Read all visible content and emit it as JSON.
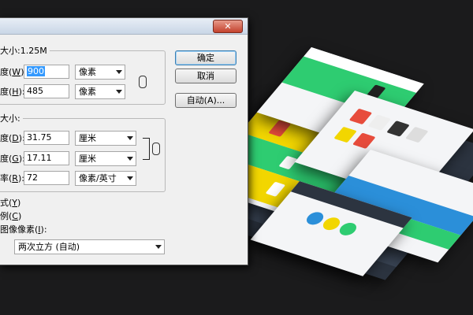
{
  "dialog": {
    "close_icon": "close-icon",
    "pixel_dimensions": {
      "legend": "大小:1.25M",
      "width_label": "度(",
      "width_key": "W",
      "width_value": "900",
      "width_unit": "像素",
      "height_label": "度(",
      "height_key": "H",
      "height_value": "485",
      "height_unit": "像素"
    },
    "document_size": {
      "legend": "大小:",
      "width_label": "度(",
      "width_key": "D",
      "width_value": "31.75",
      "width_unit": "厘米",
      "height_label": "度(",
      "height_key": "G",
      "height_value": "17.11",
      "height_unit": "厘米",
      "resolution_label": "率(",
      "resolution_key": "R",
      "resolution_value": "72",
      "resolution_unit": "像素/英寸"
    },
    "buttons": {
      "ok": "确定",
      "cancel": "取消",
      "auto": "自动(A)..."
    },
    "options": {
      "scale_styles_label": "式(",
      "scale_styles_key": "Y",
      "constrain_label": "例(",
      "constrain_key": "C",
      "resample_label": "图像像素(",
      "resample_key": "I",
      "resample_value": "两次立方 (自动)"
    },
    "close_paren": ")",
    "close_paren_colon": "):"
  },
  "colors": {
    "dialog_bg": "#f0f0f0",
    "selection": "#3399ff",
    "mockup_green": "#2ecc71",
    "mockup_yellow": "#f2d600",
    "mockup_blue": "#2b8fd9",
    "mockup_dark": "#2c3440"
  }
}
